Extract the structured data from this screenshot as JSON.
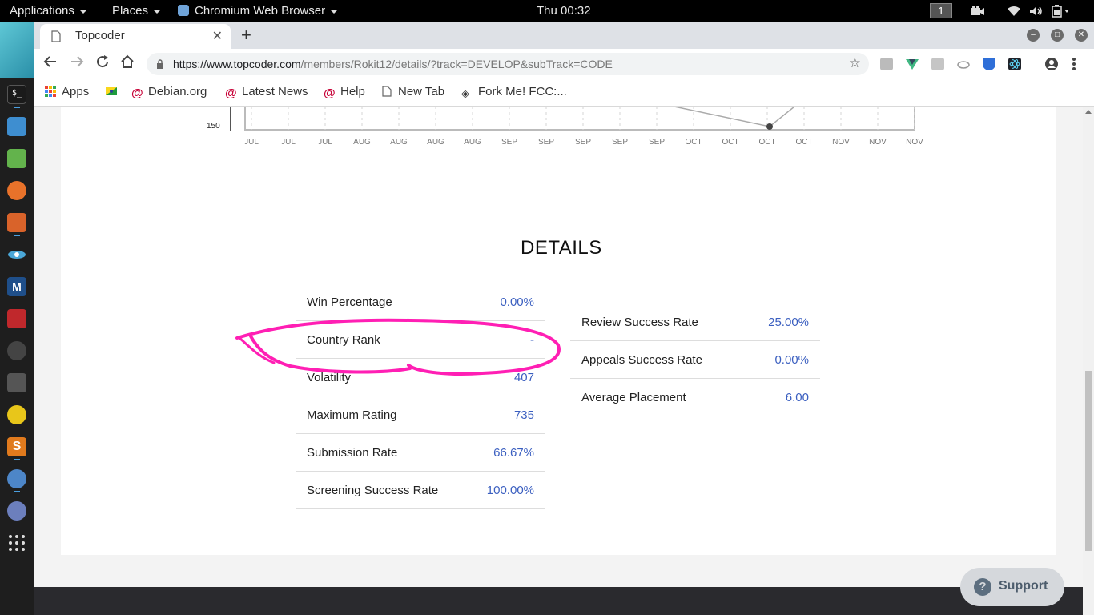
{
  "system_bar": {
    "applications": "Applications",
    "places": "Places",
    "active_app": "Chromium Web Browser",
    "clock": "Thu 00:32",
    "workspace": "1"
  },
  "browser": {
    "tab_title": "Topcoder",
    "url_host": "https://www.topcoder.com",
    "url_path": "/members/Rokit12/details/?track=DEVELOP&subTrack=CODE"
  },
  "bookmarks": [
    {
      "label": "Apps"
    },
    {
      "label": ""
    },
    {
      "label": "Debian.org"
    },
    {
      "label": "Latest News"
    },
    {
      "label": "Help"
    },
    {
      "label": "New Tab"
    },
    {
      "label": "Fork Me! FCC:..."
    }
  ],
  "chart": {
    "y_tick": "150",
    "x_ticks": [
      "JUL",
      "JUL",
      "JUL",
      "AUG",
      "AUG",
      "AUG",
      "AUG",
      "SEP",
      "SEP",
      "SEP",
      "SEP",
      "SEP",
      "OCT",
      "OCT",
      "OCT",
      "OCT",
      "NOV",
      "NOV",
      "NOV"
    ]
  },
  "details": {
    "title": "DETAILS",
    "left": [
      {
        "label": "Win Percentage",
        "value": "0.00%"
      },
      {
        "label": "Country Rank",
        "value": "-"
      },
      {
        "label": "Volatility",
        "value": "407"
      },
      {
        "label": "Maximum Rating",
        "value": "735"
      },
      {
        "label": "Submission Rate",
        "value": "66.67%"
      },
      {
        "label": "Screening Success Rate",
        "value": "100.00%"
      }
    ],
    "right": [
      {
        "label": "Review Success Rate",
        "value": "25.00%"
      },
      {
        "label": "Appeals Success Rate",
        "value": "0.00%"
      },
      {
        "label": "Average Placement",
        "value": "6.00"
      }
    ]
  },
  "support": {
    "label": "Support",
    "icon": "?"
  },
  "colors": {
    "value_blue": "#3b5fc0",
    "annotation": "#ff1fb4"
  }
}
